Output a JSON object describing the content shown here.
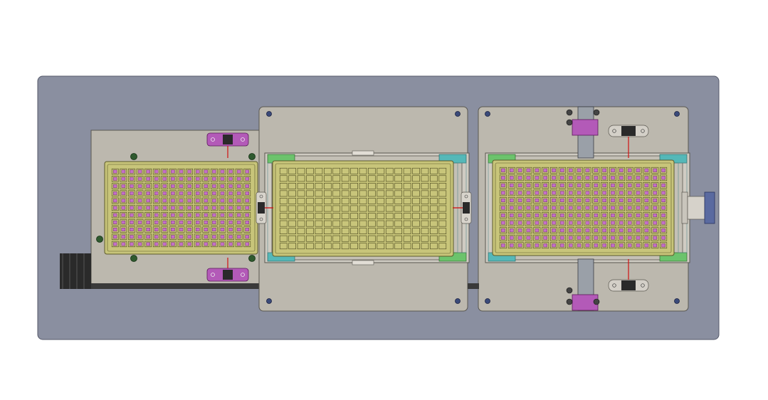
{
  "drawing": {
    "view": "top view",
    "colors": {
      "background": "#ffffff",
      "base_plate": "#8a8fa0",
      "panel": "#bcb8ae",
      "panel_stroke": "#5a5750",
      "tray": "#c8c57a",
      "tray_stroke": "#5c5a2a",
      "cell_pink": "#c36fc8",
      "cell_empty": "#c8c57a",
      "clip_magenta": "#b35ab8",
      "corner_green": "#6cc36c",
      "corner_teal": "#55b8b8",
      "bolt": "#3a4a7a",
      "post_green": "#2f5a2f",
      "dark": "#2a2a2a",
      "red_line": "#d01010",
      "motor_blue": "#5a6aa0"
    },
    "trays": [
      {
        "id": "left-tray",
        "cells": "filled"
      },
      {
        "id": "middle-tray",
        "cells": "empty"
      },
      {
        "id": "right-tray",
        "cells": "filled"
      }
    ],
    "icons": [
      "bolt-icon",
      "clip-icon",
      "latch-icon",
      "motor-icon",
      "cable-chain-icon"
    ]
  }
}
